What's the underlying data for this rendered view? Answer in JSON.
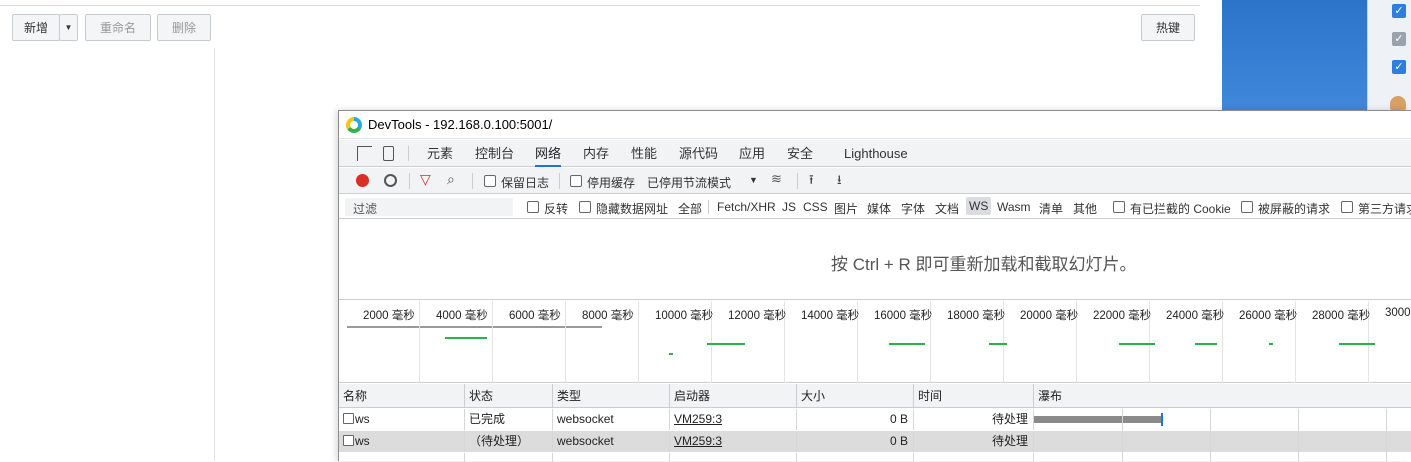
{
  "app": {
    "toolbar": {
      "add_label": "新增",
      "rename_label": "重命名",
      "delete_label": "删除",
      "hotkey_label": "热键"
    }
  },
  "devtools": {
    "title": "DevTools - 192.168.0.100:5001/",
    "tabs": [
      {
        "label": "元素"
      },
      {
        "label": "控制台"
      },
      {
        "label": "网络",
        "active": true
      },
      {
        "label": "内存"
      },
      {
        "label": "性能"
      },
      {
        "label": "源代码"
      },
      {
        "label": "应用"
      },
      {
        "label": "安全"
      },
      {
        "label": "Lighthouse"
      }
    ],
    "toolbar": {
      "preserve_log": "保留日志",
      "disable_cache": "停用缓存",
      "throttling": "已停用节流模式"
    },
    "filter": {
      "placeholder": "过滤",
      "invert": "反转",
      "hide_data_urls": "隐藏数据网址",
      "types": [
        "全部",
        "Fetch/XHR",
        "JS",
        "CSS",
        "图片",
        "媒体",
        "字体",
        "文档",
        "WS",
        "Wasm",
        "清单",
        "其他"
      ],
      "active_type": "WS",
      "blocked_cookies": "有已拦截的 Cookie",
      "blocked_requests": "被屏蔽的请求",
      "third_party": "第三方请求"
    },
    "reload_message": "按 Ctrl + R 即可重新加载和截取幻灯片。",
    "overview_ticks": [
      "2000 毫秒",
      "4000 毫秒",
      "6000 毫秒",
      "8000 毫秒",
      "10000 毫秒",
      "12000 毫秒",
      "14000 毫秒",
      "16000 毫秒",
      "18000 毫秒",
      "20000 毫秒",
      "22000 毫秒",
      "24000 毫秒",
      "26000 毫秒",
      "28000 毫秒",
      "30000"
    ],
    "table": {
      "headers": {
        "name": "名称",
        "status": "状态",
        "type": "类型",
        "initiator": "启动器",
        "size": "大小",
        "time": "时间",
        "waterfall": "瀑布"
      },
      "rows": [
        {
          "name": "ws",
          "status": "已完成",
          "type": "websocket",
          "initiator": "VM259:3",
          "size": "0 B",
          "time": "待处理"
        },
        {
          "name": "ws",
          "status": "（待处理）",
          "type": "websocket",
          "initiator": "VM259:3",
          "size": "0 B",
          "time": "待处理"
        }
      ]
    }
  },
  "colors": {
    "accent": "#1a73e8",
    "record": "#d93025",
    "filter_icon": "#d93025",
    "overview_green": "#2ab24c",
    "panel_blue": "#2b74c9"
  }
}
